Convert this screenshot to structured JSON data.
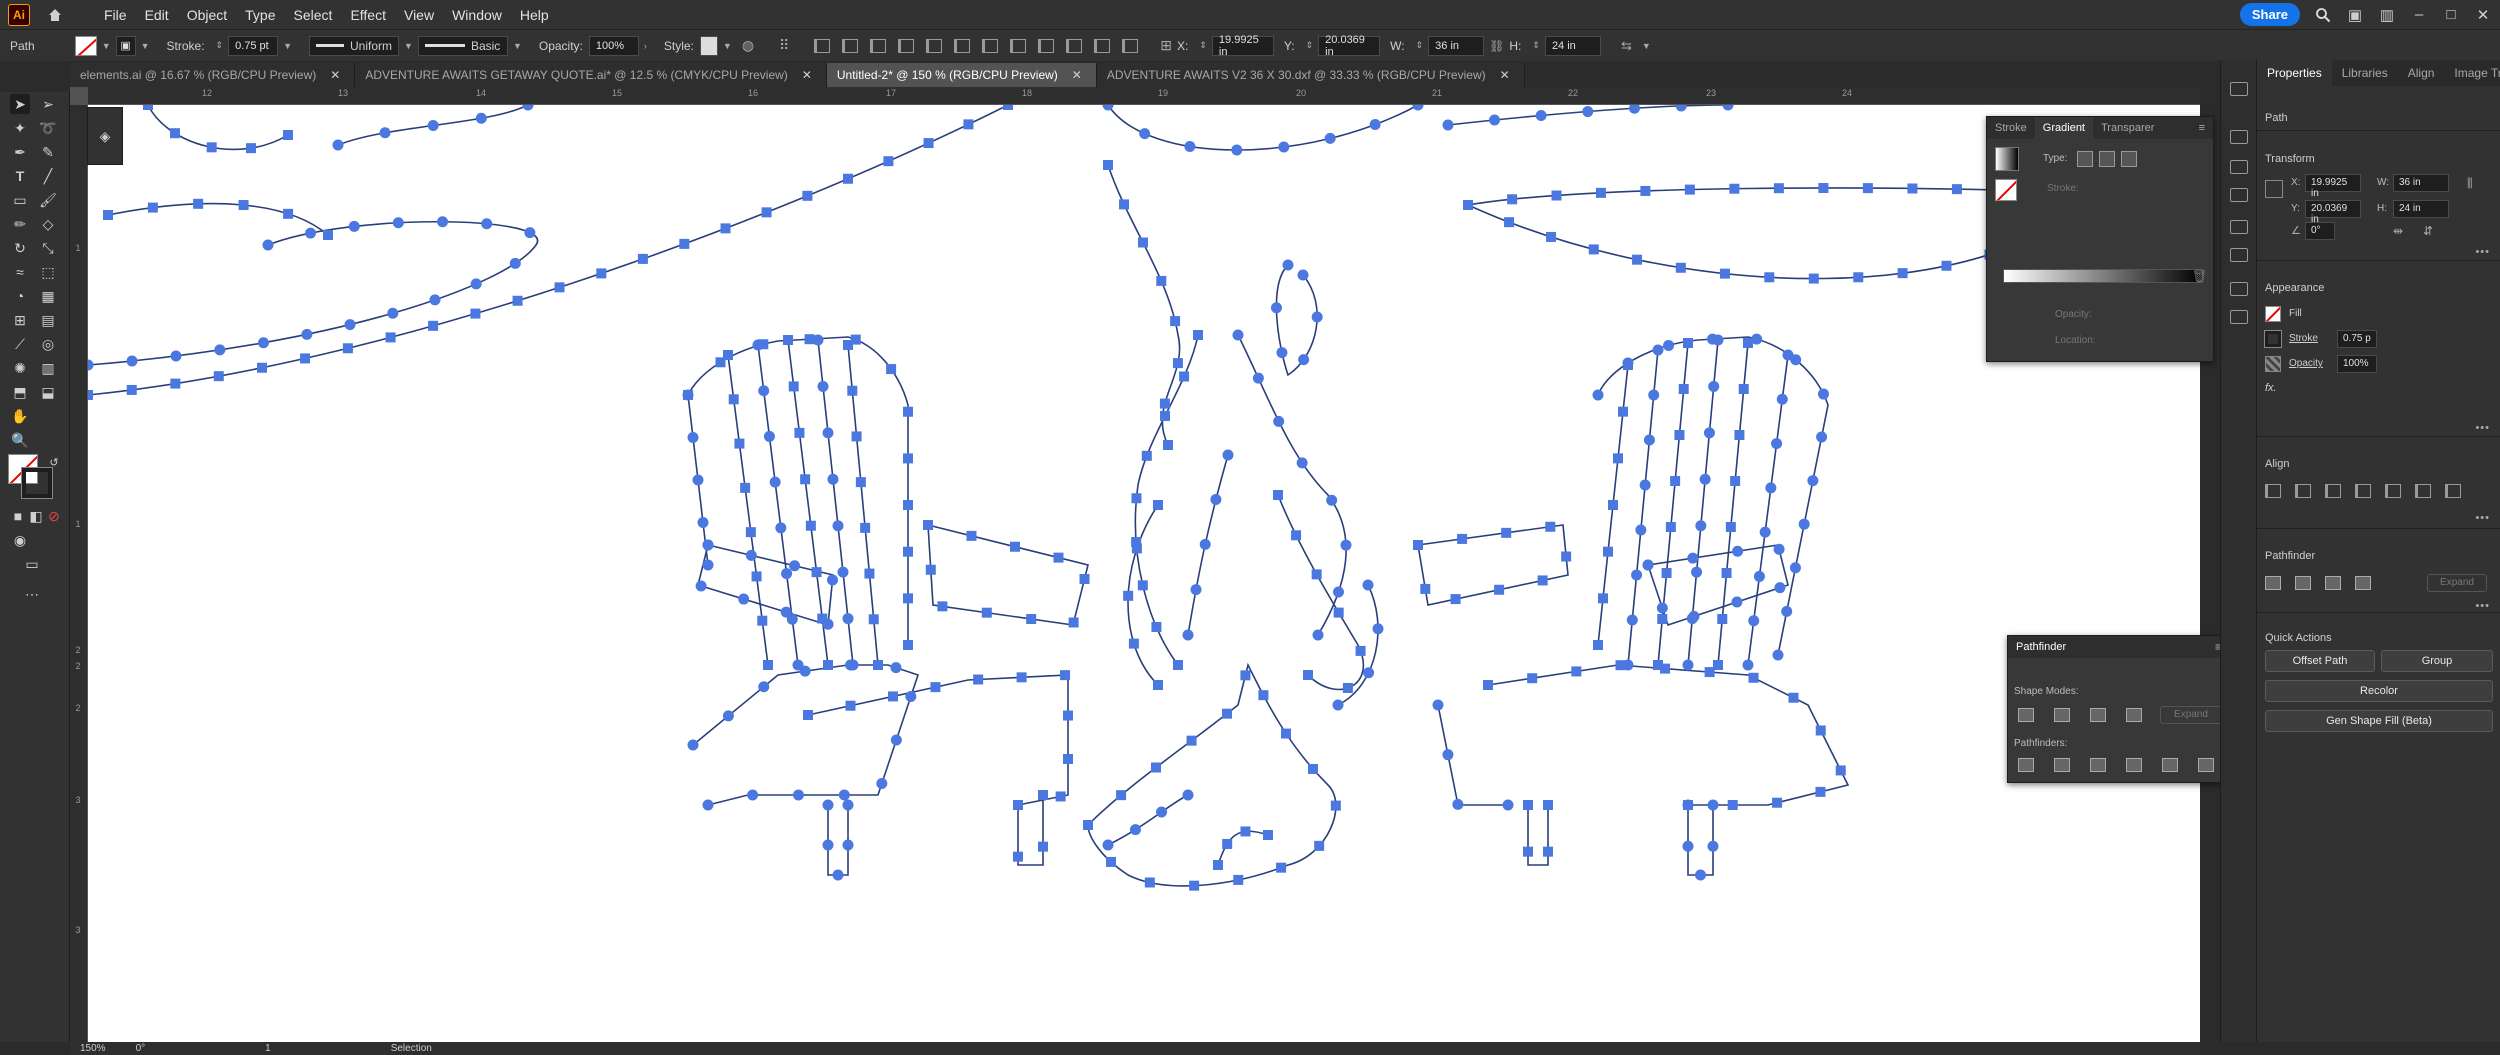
{
  "app": {
    "logo": "Ai",
    "menus": [
      "File",
      "Edit",
      "Object",
      "Type",
      "Select",
      "Effect",
      "View",
      "Window",
      "Help"
    ],
    "share_label": "Share"
  },
  "control_bar": {
    "selection_type": "Path",
    "stroke_label": "Stroke:",
    "stroke_weight": "0.75 pt",
    "stroke_profile": "Uniform",
    "brush": "Basic",
    "opacity_label": "Opacity:",
    "opacity_value": "100%",
    "style_label": "Style:",
    "x_label": "X:",
    "x_value": "19.9925 in",
    "y_label": "Y:",
    "y_value": "20.0369 in",
    "w_label": "W:",
    "w_value": "36 in",
    "h_label": "H:",
    "h_value": "24 in"
  },
  "tabs": [
    {
      "label": "elements.ai @ 16.67 % (RGB/CPU Preview)",
      "active": false
    },
    {
      "label": "ADVENTURE AWAITS GETAWAY QUOTE.ai* @ 12.5 % (CMYK/CPU Preview)",
      "active": false
    },
    {
      "label": "Untitled-2* @ 150 % (RGB/CPU Preview)",
      "active": true
    },
    {
      "label": "ADVENTURE AWAITS V2 36 X 30.dxf @ 33.33 % (RGB/CPU Preview)",
      "active": false
    }
  ],
  "rulers": {
    "top": [
      "12",
      "13",
      "14",
      "15",
      "16",
      "17",
      "18",
      "19",
      "20",
      "21",
      "22",
      "23",
      "24"
    ],
    "left": [
      "1",
      "1",
      "2",
      "2",
      "2",
      "3",
      "3"
    ]
  },
  "gradient_panel": {
    "tabs": [
      "Stroke",
      "Gradient",
      "Transparer"
    ],
    "type_label": "Type:",
    "stroke_label": "Stroke:",
    "opacity_label": "Opacity:",
    "location_label": "Location:"
  },
  "pathfinder_panel": {
    "title": "Pathfinder",
    "shape_modes_label": "Shape Modes:",
    "expand_label": "Expand",
    "pathfinders_label": "Pathfinders:"
  },
  "properties": {
    "tabs": [
      "Properties",
      "Libraries",
      "Align",
      "Image Tra"
    ],
    "selection": "Path",
    "transform_title": "Transform",
    "x_label": "X:",
    "x_value": "19.9925 in",
    "y_label": "Y:",
    "y_value": "20.0369 in",
    "w_label": "W:",
    "w_value": "36 in",
    "h_label": "H:",
    "h_value": "24 in",
    "angle_value": "0°",
    "appearance_title": "Appearance",
    "fill_label": "Fill",
    "stroke_label": "Stroke",
    "stroke_value": "0.75 p",
    "opacity_label": "Opacity",
    "opacity_value": "100%",
    "fx_label": "fx.",
    "align_title": "Align",
    "pathfinder_title": "Pathfinder",
    "expand_label": "Expand",
    "quick_actions_title": "Quick Actions",
    "offset_path": "Offset Path",
    "group": "Group",
    "recolor": "Recolor",
    "gen_shape_fill": "Gen Shape Fill (Beta)"
  },
  "status_bar": {
    "zoom": "150%",
    "rotation": "0°",
    "artboard": "1",
    "tool": "Selection"
  },
  "colors": {
    "accent": "#1473e6",
    "path_stroke": "#2a3f7a",
    "anchor": "#4a78e0"
  }
}
